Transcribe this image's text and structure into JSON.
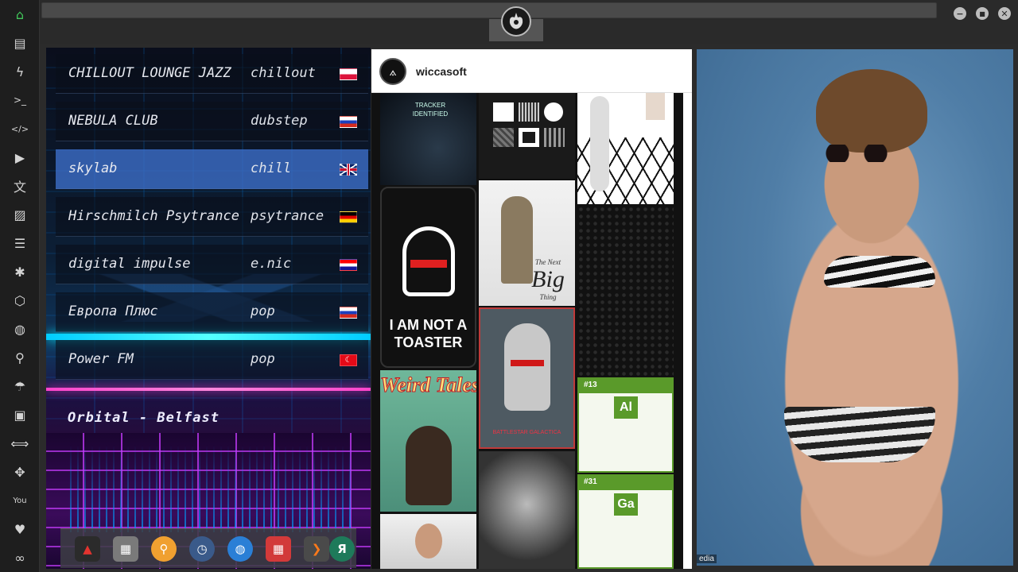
{
  "window": {
    "minimize_glyph": "−",
    "maximize_glyph": "■",
    "close_glyph": "✕",
    "logo_icon": "rebel-alliance-icon"
  },
  "sidebar": {
    "items": [
      {
        "icon": "home-icon",
        "glyph": "⌂"
      },
      {
        "icon": "document-icon",
        "glyph": "▤"
      },
      {
        "icon": "lightning-icon",
        "glyph": "ϟ"
      },
      {
        "icon": "terminal-icon",
        "glyph": ">_"
      },
      {
        "icon": "code-icon",
        "glyph": "</>"
      },
      {
        "icon": "play-icon",
        "glyph": "▶"
      },
      {
        "icon": "translate-icon",
        "glyph": "文"
      },
      {
        "icon": "image-icon",
        "glyph": "▨"
      },
      {
        "icon": "news-icon",
        "glyph": "☰"
      },
      {
        "icon": "asterisk-icon",
        "glyph": "✱"
      },
      {
        "icon": "hexagon-icon",
        "glyph": "⬡"
      },
      {
        "icon": "globe-icon",
        "glyph": "◍"
      },
      {
        "icon": "search-icon",
        "glyph": "⚲"
      },
      {
        "icon": "umbrella-icon",
        "glyph": "☂"
      },
      {
        "icon": "contact-icon",
        "glyph": "▣"
      },
      {
        "icon": "link-icon",
        "glyph": "⟺"
      },
      {
        "icon": "expand-icon",
        "glyph": "✥"
      },
      {
        "icon": "youtube-icon",
        "glyph": "You"
      },
      {
        "icon": "heart-icon",
        "glyph": "♥"
      },
      {
        "icon": "infinity-icon",
        "glyph": "∞"
      }
    ]
  },
  "radio": {
    "stations": [
      {
        "name": "CHILLOUT LOUNGE JAZZ",
        "genre": "chillout",
        "flag": "pl"
      },
      {
        "name": "NEBULA CLUB",
        "genre": "dubstep",
        "flag": "ru"
      },
      {
        "name": "skylab",
        "genre": "chill",
        "flag": "gb"
      },
      {
        "name": "Hirschmilch Psytrance",
        "genre": "psytrance",
        "flag": "de"
      },
      {
        "name": "digital impulse",
        "genre": "e.nic",
        "flag": "hr"
      },
      {
        "name": "Европа Плюс",
        "genre": "pop",
        "flag": "ru"
      },
      {
        "name": "Power FM",
        "genre": "pop",
        "flag": "tr"
      }
    ],
    "active_index": 2,
    "now_playing": "Orbital - Belfast",
    "flag_tr_glyph": "☾"
  },
  "dock": {
    "items": [
      {
        "icon": "red-triangle-app-icon",
        "glyph": "▲",
        "color": "#e3342f",
        "bg": "#2b2b2b"
      },
      {
        "icon": "news-reader-icon",
        "glyph": "▦",
        "color": "#ffffff",
        "bg": "#7a7a7a"
      },
      {
        "icon": "magnifier-icon",
        "glyph": "⚲",
        "color": "#ffffff",
        "bg": "#f0a030"
      },
      {
        "icon": "clock-icon",
        "glyph": "◷",
        "color": "#ffffff",
        "bg": "#3a5a8a"
      },
      {
        "icon": "globe-icon",
        "glyph": "◍",
        "color": "#ffffff",
        "bg": "#2a7fd6"
      },
      {
        "icon": "calendar-icon",
        "glyph": "▦",
        "color": "#ffffff",
        "bg": "#d23a3a"
      },
      {
        "icon": "arrow-icon",
        "glyph": "❯",
        "color": "#ff7a1a",
        "bg": "#4a4a4a"
      },
      {
        "icon": "yandex-icon",
        "glyph": "Я",
        "color": "#ffffff",
        "bg": "#1e7a5a"
      }
    ]
  },
  "pinboard": {
    "username": "wiccasoft",
    "avatar_glyph": "⟑",
    "tiles": {
      "tracker_text": "TRACKER IDENTIFIED",
      "toaster_text_line1": "I AM NOT A",
      "toaster_text_line2": "TOASTER",
      "weird_tales_title": "Weird Tales",
      "big_thing_the": "The Next",
      "big_thing_big": "Big",
      "big_thing_thing": "Thing",
      "galactica_title": "BATTLESTAR GALACTICA",
      "element_num_13": "#13",
      "element_al": "Al",
      "element_num_31": "#31",
      "element_ga": "Ga"
    }
  },
  "photo": {
    "credit": "edia"
  }
}
